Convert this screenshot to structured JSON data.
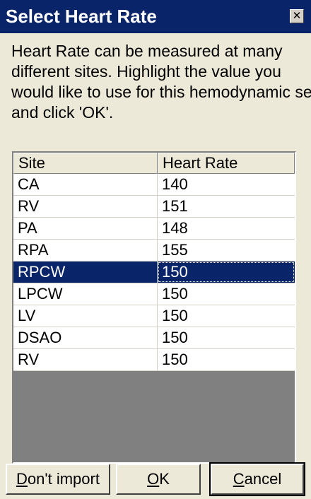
{
  "dialog": {
    "title": "Select Heart Rate",
    "close_glyph": "✕",
    "instructions_lines": [
      "Heart Rate can be measured at many",
      "different sites. Highlight the value you",
      "would like to use for this hemodynamic set",
      "and click 'OK'."
    ]
  },
  "table": {
    "columns": [
      "Site",
      "Heart Rate"
    ],
    "rows": [
      {
        "site": "CA",
        "rate": "140"
      },
      {
        "site": "RV",
        "rate": "151"
      },
      {
        "site": "PA",
        "rate": "148"
      },
      {
        "site": "RPA",
        "rate": "155"
      },
      {
        "site": "RPCW",
        "rate": "150",
        "selected": true
      },
      {
        "site": "LPCW",
        "rate": "150"
      },
      {
        "site": "LV",
        "rate": "150"
      },
      {
        "site": "DSAO",
        "rate": "150"
      },
      {
        "site": "RV",
        "rate": "150"
      }
    ]
  },
  "buttons": {
    "dont_import": {
      "mnemonic": "D",
      "rest": "on't import"
    },
    "ok": {
      "mnemonic": "O",
      "rest": "K"
    },
    "cancel": {
      "mnemonic": "C",
      "rest": "ancel"
    }
  },
  "colors": {
    "titlebar": "#0a246a",
    "selection": "#0a246a",
    "face": "#ece9d8",
    "empty_list_area": "#808080"
  }
}
